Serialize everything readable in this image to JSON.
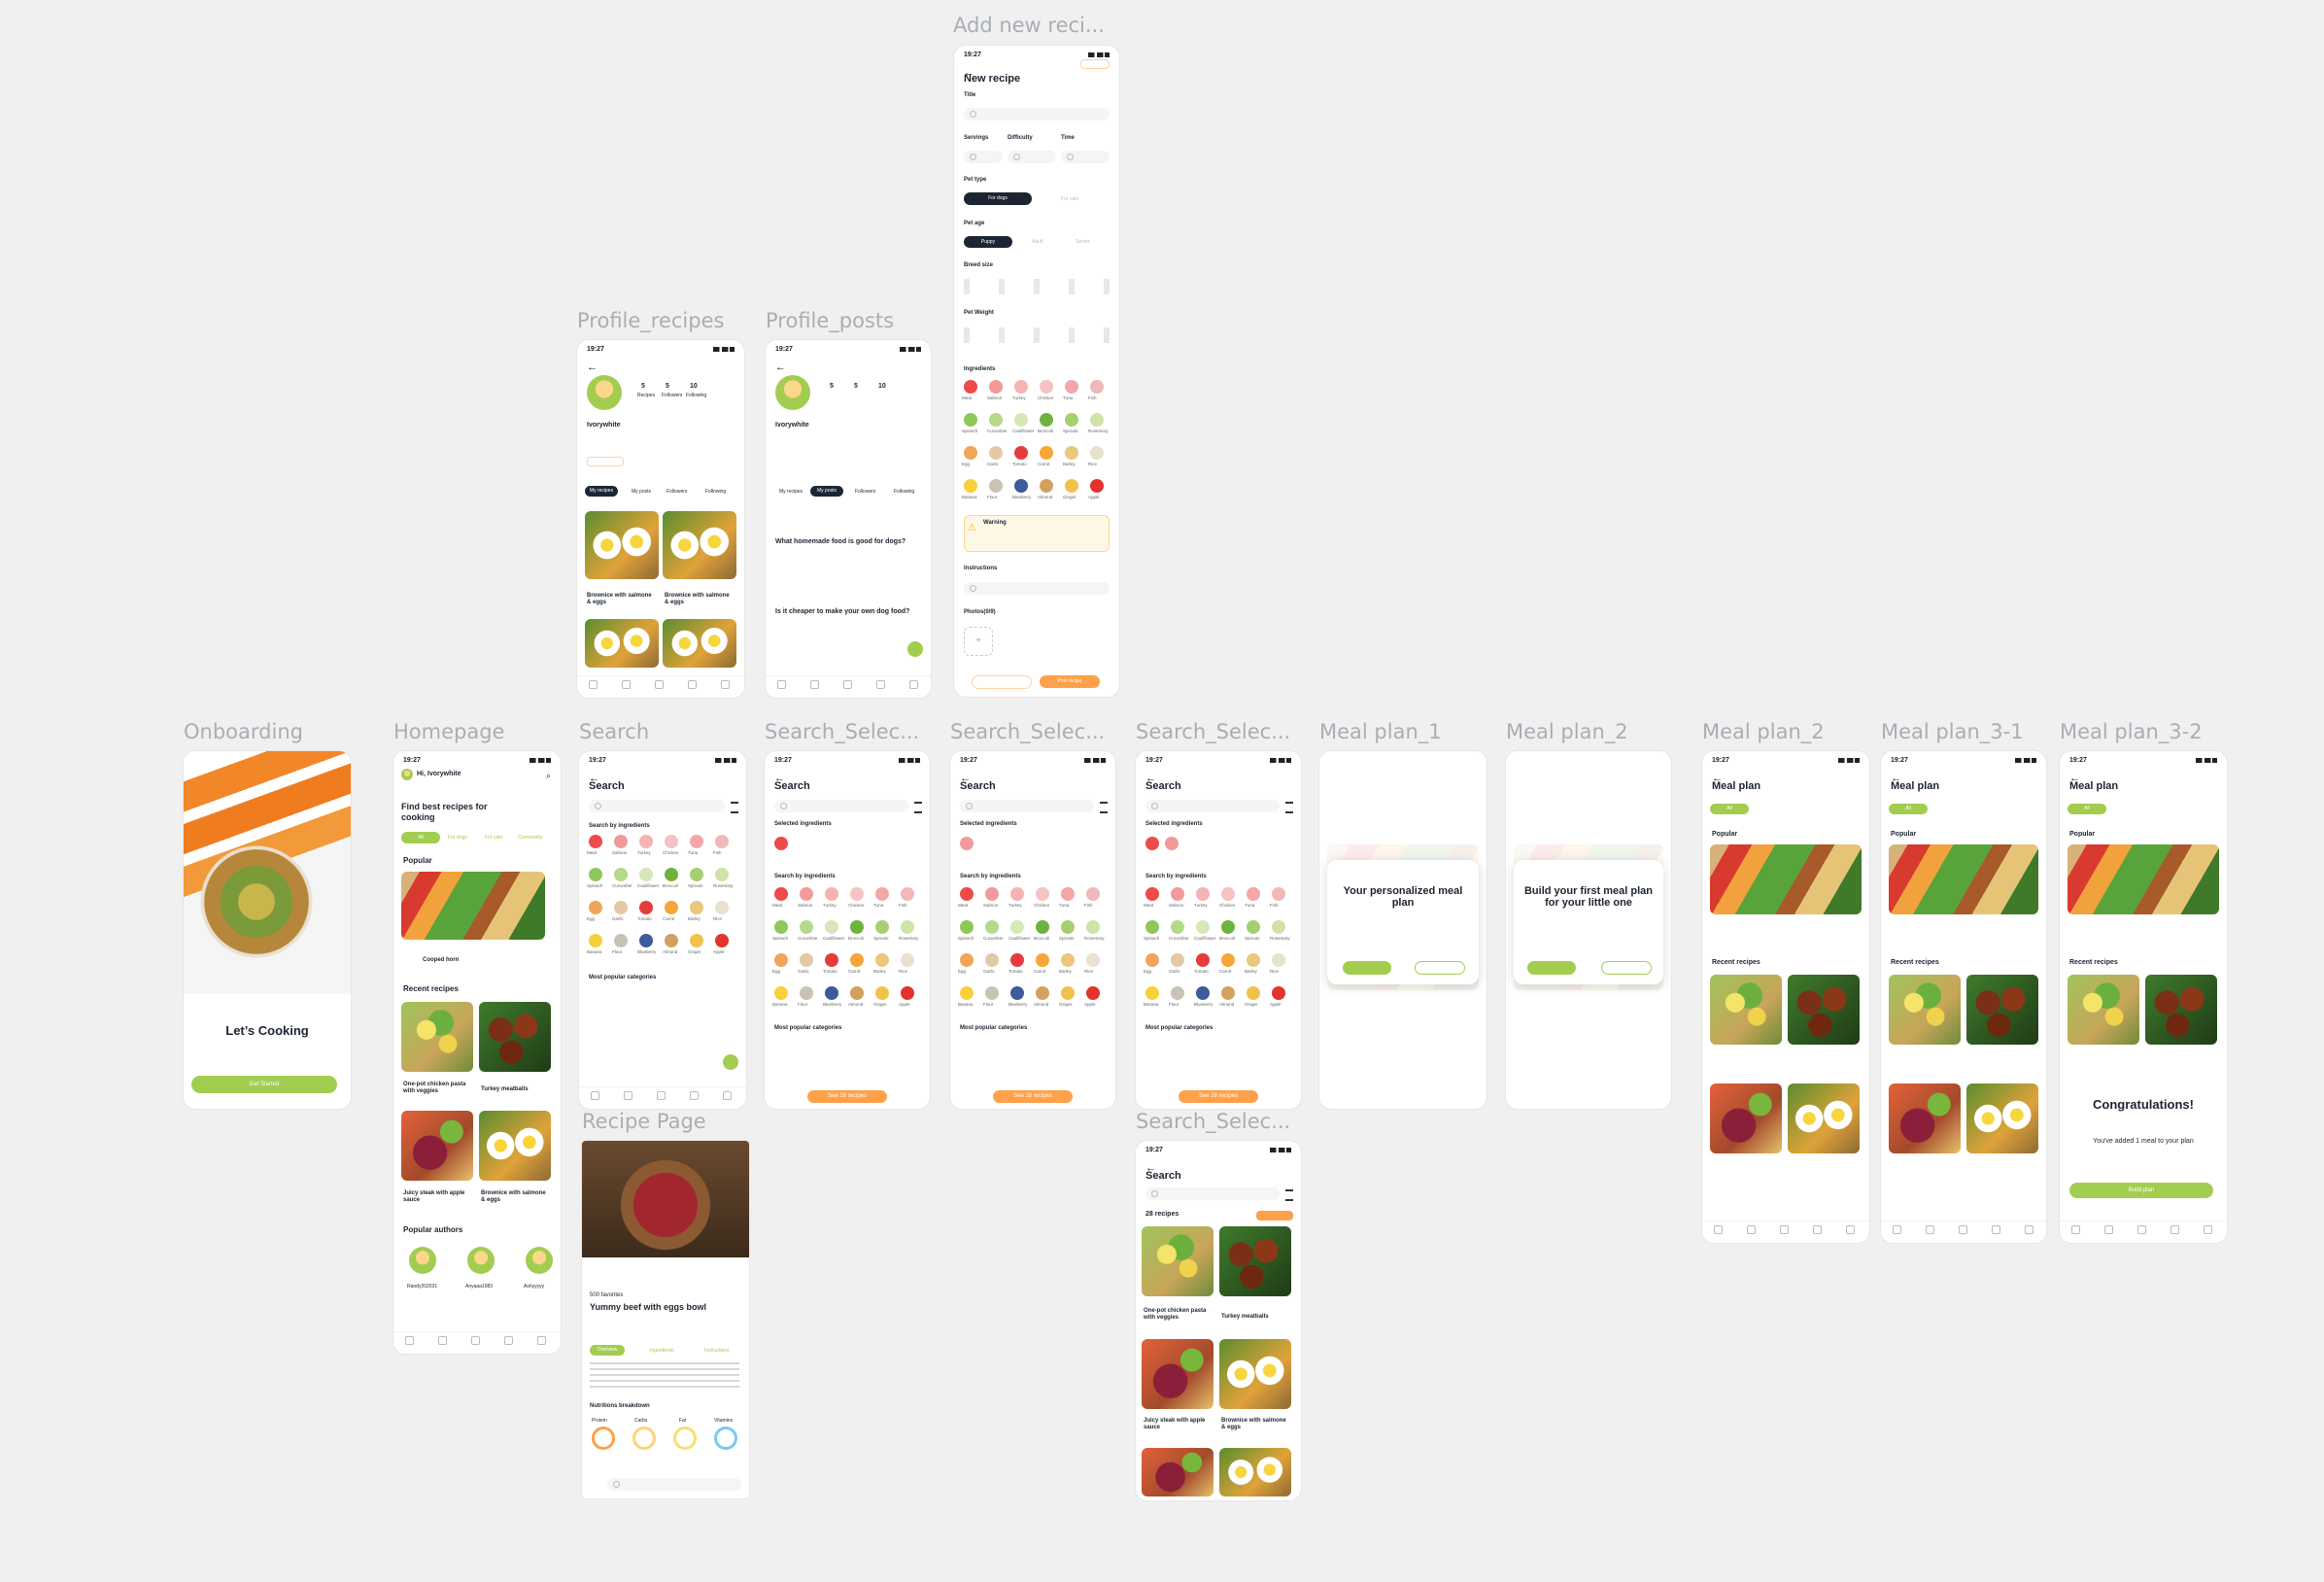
{
  "frames": {
    "add_recipe": "Add new reci...",
    "profile_recipes": "Profile_recipes",
    "profile_posts": "Profile_posts",
    "onboarding": "Onboarding",
    "homepage": "Homepage",
    "search": "Search",
    "search_selected_1": "Search_Selec...",
    "search_selected_2": "Search_Selec...",
    "search_selected_3": "Search_Selec...",
    "search_selected_4": "Search_Selec...",
    "recipe_page": "Recipe Page",
    "meal_plan_1": "Meal plan_1",
    "meal_plan_2a": "Meal plan_2",
    "meal_plan_2b": "Meal plan_2",
    "meal_plan_3_1": "Meal plan_3-1",
    "meal_plan_3_2": "Meal plan_3-2"
  },
  "status_time": "19:27",
  "add_recipe": {
    "title": "New recipe",
    "title_label": "Title",
    "servings": "Servings",
    "difficulty": "Difficulty",
    "time": "Time",
    "pet_type": "Pet type",
    "pet_type_on": "For dogs",
    "pet_type_off": "For cats",
    "pet_age": "Pet age",
    "pet_age_on": "Puppy",
    "pet_age_2": "Adult",
    "pet_age_3": "Senior",
    "breed_size": "Breed size",
    "pet_weight": "Pet Weight",
    "ingredients": "Ingredients",
    "warning": "Warning",
    "instructions": "Instructions",
    "photos": "Photos(0/9)",
    "save_draft": "Save recipe",
    "post": "Post recipe"
  },
  "profile": {
    "username": "Ivorywhite",
    "stats": [
      {
        "num": "5",
        "label": "Recipes"
      },
      {
        "num": "5",
        "label": "Followers"
      },
      {
        "num": "10",
        "label": "Following"
      }
    ],
    "tabs": [
      "My recipes",
      "My posts",
      "Followers",
      "Following"
    ],
    "recipe_name": "Brownice with salmone & eggs",
    "post_1": "What homemade food is good for dogs?",
    "post_2": "Is it cheaper to make your own dog food?"
  },
  "onboarding": {
    "title": "Let’s Cooking",
    "cta": "Get Started"
  },
  "homepage": {
    "greeting": "Hi, Ivorywhite",
    "headline": "Find best recipes for cooking",
    "tabs": [
      "All",
      "For dogs",
      "For cats",
      "Community"
    ],
    "popular": "Popular",
    "popular_item": "Cooped horn",
    "recent": "Recent recipes",
    "recent_items": [
      "One-pot chicken pasta with veggies",
      "Turkey meatballs",
      "Juicy steak with apple sauce",
      "Brownice with salmone & eggs"
    ],
    "authors": "Popular authors",
    "author_names": [
      "Randy202031",
      "Anyaaa1983",
      "Ashyyyyy"
    ]
  },
  "search": {
    "title": "Search",
    "by_ingredients": "Search by ingredients",
    "selected": "Selected ingredients",
    "popular_categories": "Most popular categories",
    "see_recipes": "See 28 recipes",
    "results_count": "28 recipes",
    "ingredient_labels": [
      "Meat",
      "Salmon",
      "Turkey",
      "Chicken",
      "Tuna",
      "Fish",
      "Spinach",
      "Cucumber",
      "Cauliflower",
      "Broccoli",
      "Sprouts",
      "Rosemary",
      "Egg",
      "Garlic",
      "Tomato",
      "Carrot",
      "Barley",
      "Rice",
      "Banana",
      "Flour",
      "Blueberry",
      "Almond",
      "Ginger",
      "Apple"
    ]
  },
  "recipe_page": {
    "favorites": "500 favorites",
    "title": "Yummy beef with eggs bowl",
    "tabs": [
      "Overview",
      "Ingredients",
      "Instructions"
    ],
    "nutrition": "Nutritions breakdown",
    "nutrients": [
      "Protein",
      "Carbs",
      "Fat",
      "Vitamins"
    ]
  },
  "meal_plan": {
    "title": "Meal plan",
    "dialog_1": "Your personalized meal plan",
    "dialog_2": "Build your first meal plan for your little one",
    "congrats": "Congratulations!",
    "congrats_sub": "You've added 1 meal to your plan",
    "congrats_cta": "Build plan"
  }
}
